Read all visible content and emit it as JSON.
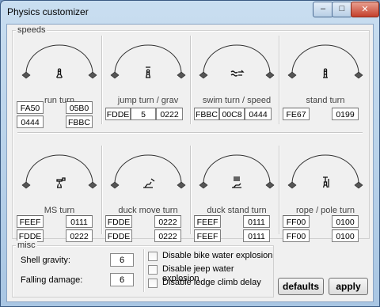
{
  "window": {
    "title": "Physics customizer"
  },
  "speeds": {
    "label": "speeds",
    "cells": [
      {
        "label": "run turn",
        "icon": "walking-figure-icon",
        "v1": "FA50",
        "v2": "05B0",
        "v3": "0444",
        "v4": "FBBC"
      },
      {
        "label": "jump turn / grav",
        "icon": "jumping-figure-icon",
        "v1": "FDDE",
        "v2": "5",
        "v3": "0222"
      },
      {
        "label": "swim turn / speed",
        "icon": "swimming-figure-icon",
        "v1": "FBBC",
        "v2": "00C8",
        "v3": "0444"
      },
      {
        "label": "stand turn",
        "icon": "standing-figure-icon",
        "v1": "FE67",
        "v2": "0199"
      },
      {
        "label": "MS turn",
        "icon": "shooting-figure-icon",
        "v1": "FEEF",
        "v2": "0111",
        "v3": "FDDE",
        "v4": "0222"
      },
      {
        "label": "duck move turn",
        "icon": "ducking-figure-icon",
        "v1": "FDDE",
        "v2": "0222",
        "v3": "FDDE",
        "v4": "0222"
      },
      {
        "label": "duck stand turn",
        "icon": "ducking-stand-figure-icon",
        "v1": "FEEF",
        "v2": "0111",
        "v3": "FEEF",
        "v4": "0111"
      },
      {
        "label": "rope / pole turn",
        "icon": "rope-figure-icon",
        "v1": "FF00",
        "v2": "0100",
        "v3": "FF00",
        "v4": "0100"
      }
    ]
  },
  "misc": {
    "label": "misc",
    "shell_gravity_label": "Shell gravity:",
    "shell_gravity": "6",
    "falling_damage_label": "Falling damage:",
    "falling_damage": "6"
  },
  "options": [
    {
      "label": "Disable bike water explosion",
      "checked": false
    },
    {
      "label": "Disable jeep water explosion",
      "checked": false
    },
    {
      "label": "Disable ledge climb delay",
      "checked": false
    }
  ],
  "buttons": {
    "defaults": "defaults",
    "apply": "apply"
  }
}
